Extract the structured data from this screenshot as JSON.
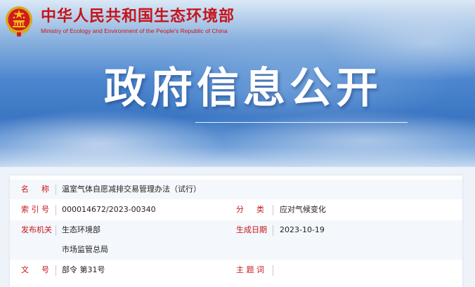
{
  "header": {
    "ministry_name_cn": "中华人民共和国生态环境部",
    "ministry_name_en": "Ministry of Ecology and Environment of the People's Republic of China",
    "banner_title": "政府信息公开"
  },
  "info": {
    "name_label": [
      "名",
      "称"
    ],
    "name_value": "温室气体自愿减排交易管理办法（试行）",
    "index_label": [
      "索",
      "引",
      "号"
    ],
    "index_value": "000014672/2023-00340",
    "category_label": [
      "分",
      "类"
    ],
    "category_value": "应对气候变化",
    "issuer_label": "发布机关",
    "issuer_value_1": "生态环境部",
    "issuer_value_2": "市场监管总局",
    "date_label": "生成日期",
    "date_value": "2023-10-19",
    "docno_label": [
      "文",
      "号"
    ],
    "docno_value": "部令 第31号",
    "subject_label": [
      "主",
      "题",
      "词"
    ],
    "subject_value": ""
  },
  "colors": {
    "brand_red": "#c6151b",
    "banner_blue": "#3b76c3"
  }
}
